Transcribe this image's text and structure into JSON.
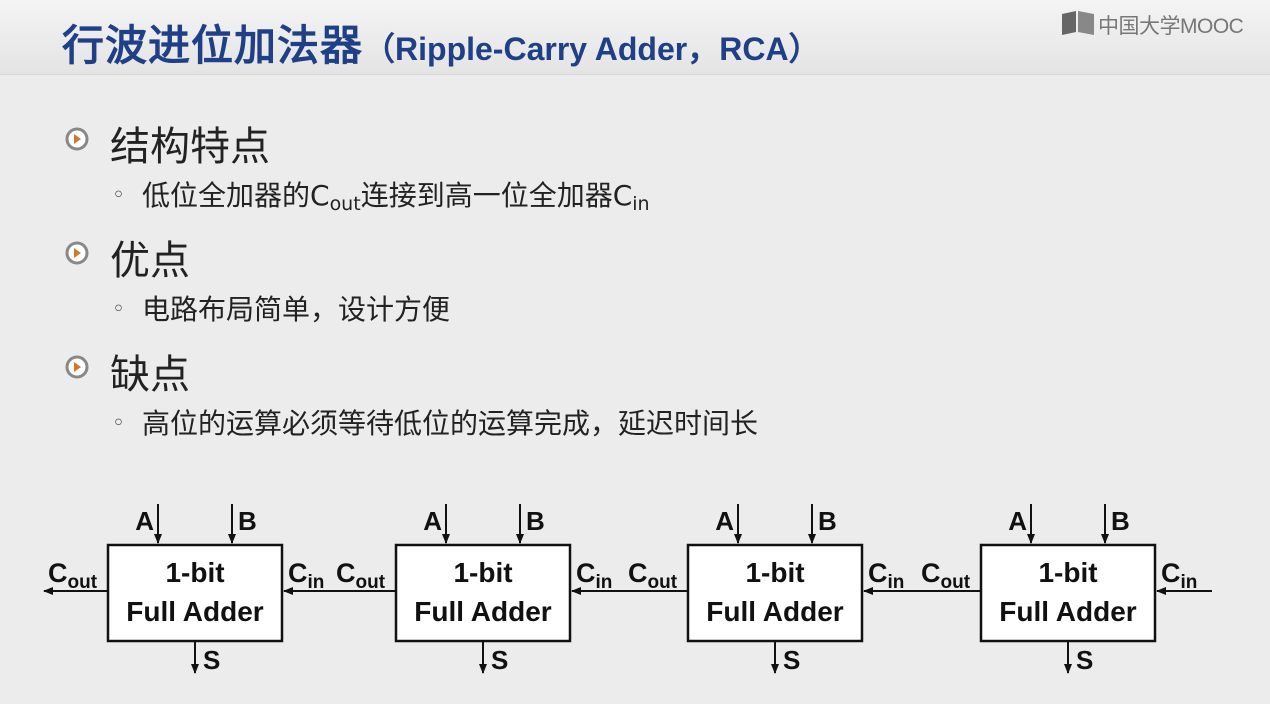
{
  "title": {
    "zh": "行波进位加法器",
    "en": "（Ripple-Carry Adder，RCA）"
  },
  "logo": {
    "text": "中国大学MOOC",
    "icon": "book-icon"
  },
  "sections": [
    {
      "heading": "结构特点",
      "item": {
        "a": "低位全加器的C",
        "a_sub": "out",
        "b": "连接到高一位全加器C",
        "b_sub": "in"
      }
    },
    {
      "heading": "优点",
      "item": {
        "text": "电路布局简单，设计方便"
      }
    },
    {
      "heading": "缺点",
      "item": {
        "text": "高位的运算必须等待低位的运算完成，延迟时间长"
      }
    }
  ],
  "bullet_icon": "circle-arrow-icon",
  "diagram": {
    "block_line1": "1-bit",
    "block_line2": "Full Adder",
    "input_a": "A",
    "input_b": "B",
    "output_s": "S",
    "carry": "C",
    "sub_out": "out",
    "sub_in": "in"
  }
}
